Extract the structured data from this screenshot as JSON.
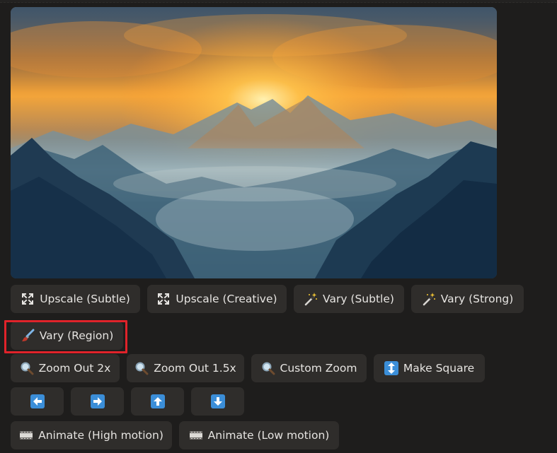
{
  "buttons": {
    "upscale_subtle": "Upscale (Subtle)",
    "upscale_creative": "Upscale (Creative)",
    "vary_subtle": "Vary (Subtle)",
    "vary_strong": "Vary (Strong)",
    "vary_region": "Vary (Region)",
    "zoom_out_2x": "Zoom Out 2x",
    "zoom_out_1_5x": "Zoom Out 1.5x",
    "custom_zoom": "Custom Zoom",
    "make_square": "Make Square",
    "animate_high": "Animate (High motion)",
    "animate_low": "Animate (Low motion)"
  },
  "icons": {
    "upscale": "expand-corners-icon",
    "vary": "magic-wand-icon",
    "vary_region": "paintbrush-icon",
    "zoom": "magnifying-glass-icon",
    "make_square": "up-down-arrow-icon",
    "pan_left": "arrow-left-icon",
    "pan_right": "arrow-right-icon",
    "pan_up": "arrow-up-icon",
    "pan_down": "arrow-down-icon",
    "animate": "film-strip-icon"
  },
  "colors": {
    "background": "#1e1d1c",
    "button_bg": "#2f2d2b",
    "button_text": "#e6e4e1",
    "highlight": "#e0232a",
    "arrow_tile": "#3b8ed8"
  }
}
